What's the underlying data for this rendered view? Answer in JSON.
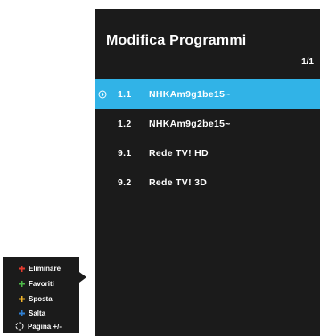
{
  "panel": {
    "title": "Modifica Programmi",
    "page_indicator": "1/1"
  },
  "channels": [
    {
      "number": "1.1",
      "name": "NHKAm9g1be15~",
      "selected": true
    },
    {
      "number": "1.2",
      "name": "NHKAm9g2be15~",
      "selected": false
    },
    {
      "number": "9.1",
      "name": "Rede TV! HD",
      "selected": false
    },
    {
      "number": "9.2",
      "name": "Rede TV! 3D",
      "selected": false
    }
  ],
  "legend": {
    "items": [
      {
        "label": "Eliminare",
        "icon": "red-button-icon",
        "color": "#e53a2e"
      },
      {
        "label": "Favoriti",
        "icon": "green-button-icon",
        "color": "#4db848"
      },
      {
        "label": "Sposta",
        "icon": "yellow-button-icon",
        "color": "#f3b52a"
      },
      {
        "label": "Salta",
        "icon": "blue-button-icon",
        "color": "#2f7fd2"
      },
      {
        "label": "Pagina +/-",
        "icon": "page-navigate-icon",
        "color": "#ffffff"
      }
    ]
  },
  "colors": {
    "panel_background": "#1b1b1b",
    "selection_highlight": "#31b3e7",
    "text": "#ffffff"
  }
}
